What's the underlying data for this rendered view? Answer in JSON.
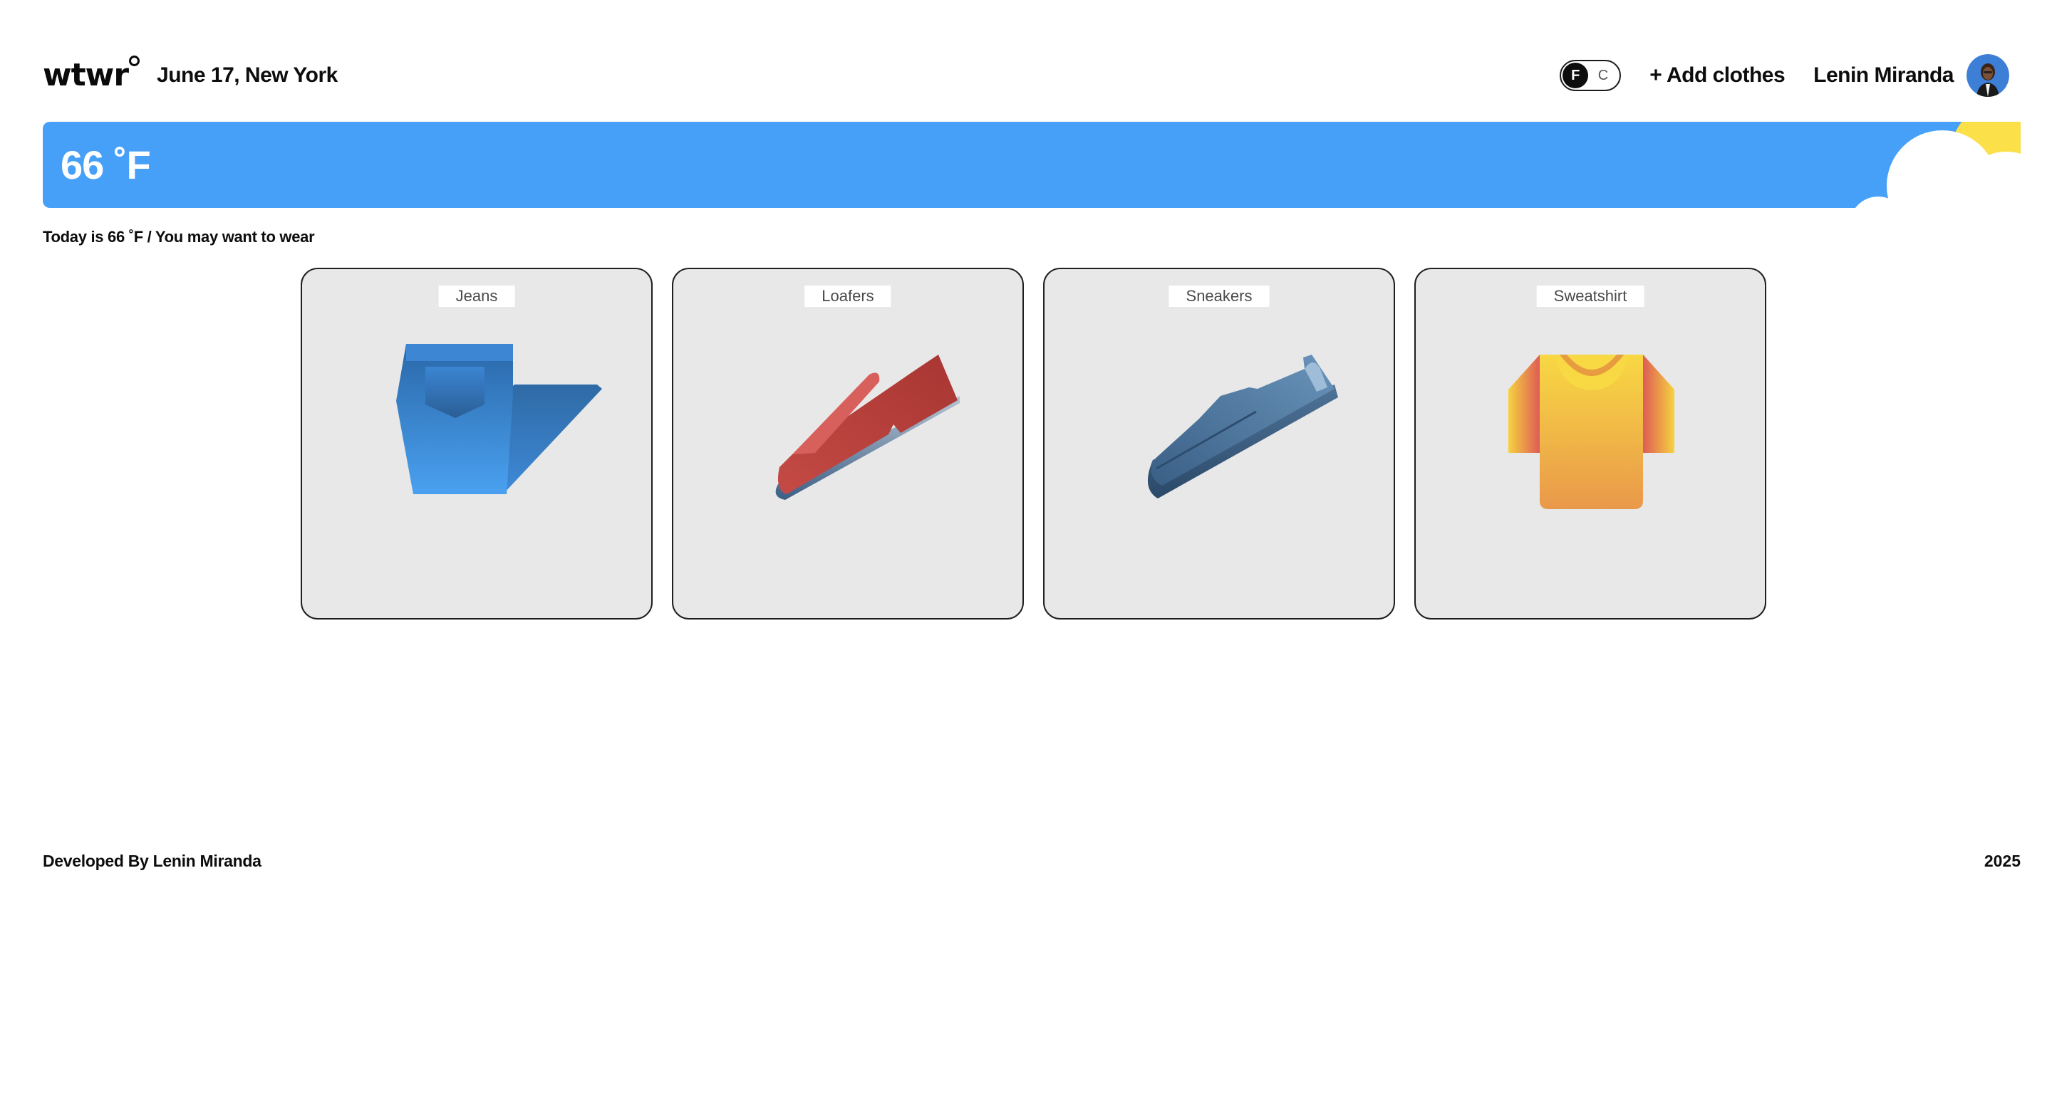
{
  "header": {
    "logo": "wtwr",
    "date_location": "June 17, New York",
    "unit_toggle": {
      "active": "F",
      "inactive": "C"
    },
    "add_clothes_label": "+ Add clothes",
    "user_name": "Lenin Miranda"
  },
  "weather": {
    "temperature": "66 ˚F",
    "banner_color": "#47a0f7",
    "condition_icons": [
      "sun-icon",
      "cloud-icon"
    ]
  },
  "suggestion_text": "Today is 66 ˚F / You may want to wear",
  "clothes": [
    {
      "label": "Jeans",
      "icon": "jeans-icon"
    },
    {
      "label": "Loafers",
      "icon": "loafers-icon"
    },
    {
      "label": "Sneakers",
      "icon": "sneakers-icon"
    },
    {
      "label": "Sweatshirt",
      "icon": "sweatshirt-icon"
    }
  ],
  "footer": {
    "developer": "Developed By Lenin Miranda",
    "year": "2025"
  }
}
